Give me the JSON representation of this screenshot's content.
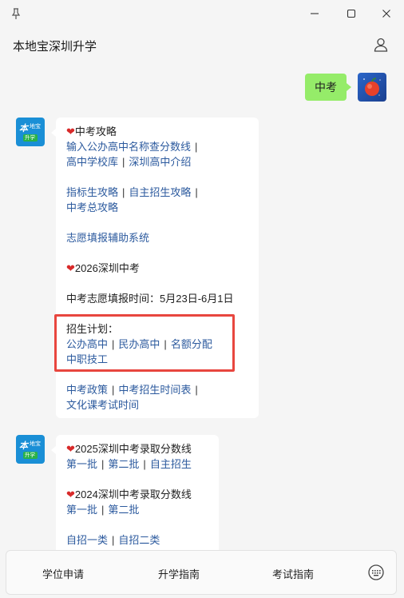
{
  "window": {
    "pin_icon": "pin-icon",
    "minimize_icon": "minimize-icon",
    "maximize_icon": "maximize-icon",
    "close_icon": "close-icon"
  },
  "header": {
    "title": "本地宝深圳升学",
    "user_icon": "user-icon"
  },
  "bot": {
    "avatar_main": "本地宝",
    "avatar_big": "本",
    "avatar_small": "地宝",
    "avatar_tag": "升学"
  },
  "user_message": {
    "text": "中考"
  },
  "message1": {
    "heading1": "中考攻略",
    "row1": {
      "link1": "输入公办高中名称查分数线",
      "sep": "|"
    },
    "row2": {
      "link1": "高中学校库",
      "link2": "深圳高中介绍",
      "sep": "|"
    },
    "row3": {
      "link1": "指标生攻略",
      "link2": "自主招生攻略",
      "sep": "|"
    },
    "row4": {
      "link1": "中考总攻略"
    },
    "row5": {
      "link1": "志愿填报辅助系统"
    },
    "heading2": "2026深圳中考",
    "note": "中考志愿填报时间：5月23日-6月1日",
    "plan_label": "招生计划：",
    "row6": {
      "link1": "公办高中",
      "link2": "民办高中",
      "link3": "名额分配",
      "sep": "|"
    },
    "row7": {
      "link1": "中职技工"
    },
    "row8": {
      "link1": "中考政策",
      "link2": "中考招生时间表",
      "sep": "|"
    },
    "row9": {
      "link1": "文化课考试时间"
    }
  },
  "message2": {
    "heading1": "2025深圳中考录取分数线",
    "row1": {
      "link1": "第一批",
      "link2": "第二批",
      "link3": "自主招生",
      "sep": "|"
    },
    "heading2": "2024深圳中考录取分数线",
    "row2": {
      "link1": "第一批",
      "link2": "第二批",
      "sep": "|"
    },
    "row3": {
      "link1": "自招一类",
      "link2": "自招二类",
      "sep": "|"
    }
  },
  "bottom": {
    "tab1": "学位申请",
    "tab2": "升学指南",
    "tab3": "考试指南",
    "keyboard_icon": "keyboard-icon"
  },
  "colors": {
    "link": "#2c5a9e",
    "user_bubble": "#95ec69",
    "highlight_border": "#e8463f",
    "heart": "#d82a2a"
  }
}
